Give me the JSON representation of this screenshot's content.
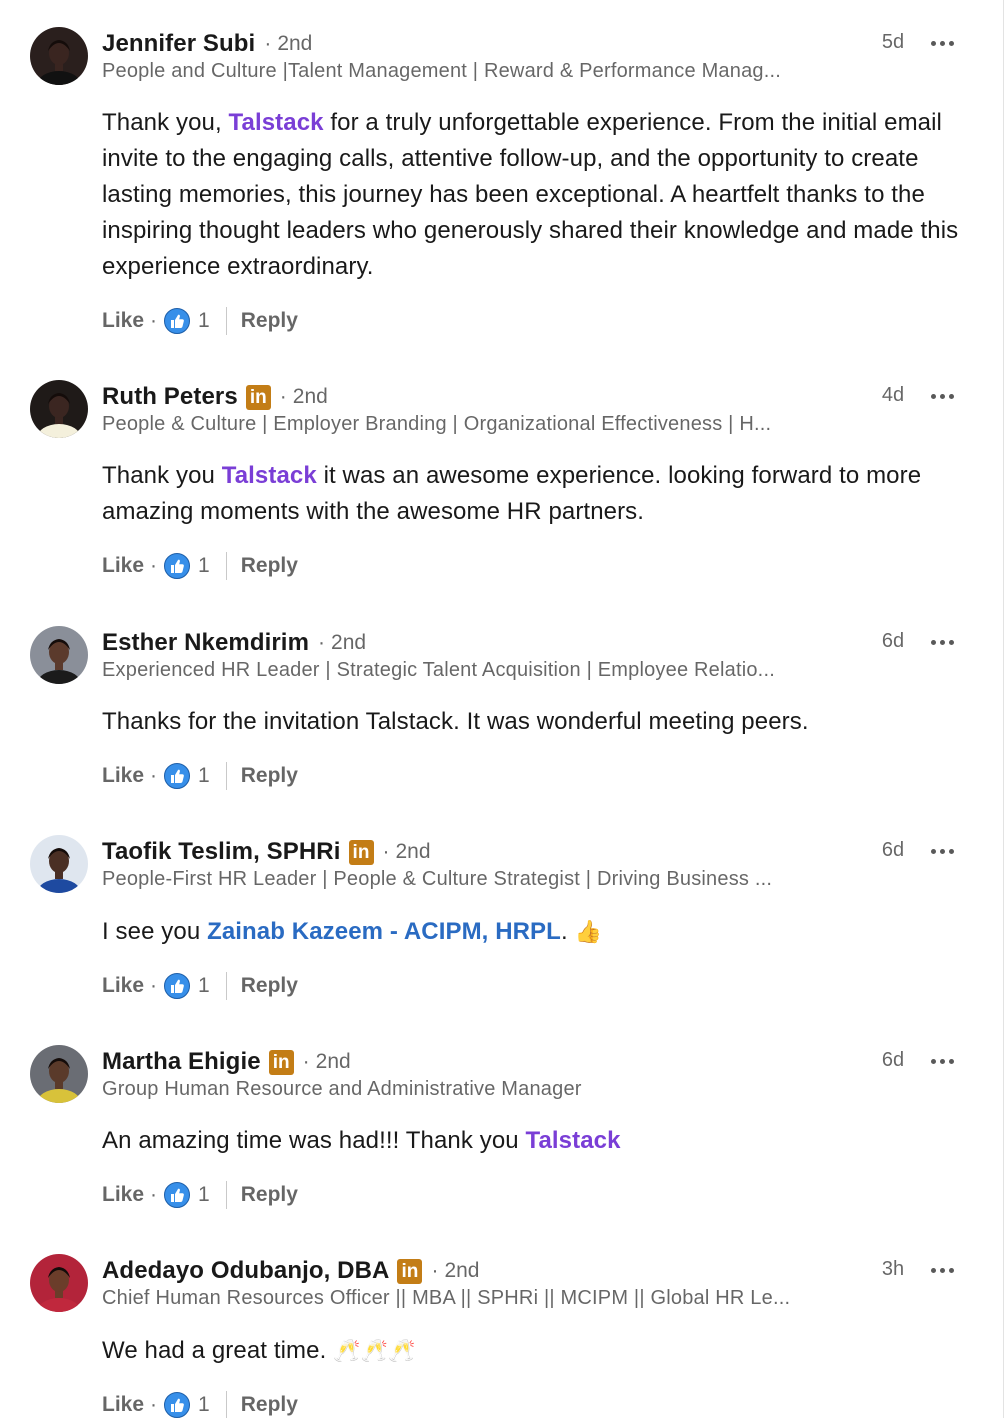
{
  "comments": [
    {
      "author": "Jennifer Subi",
      "badge": false,
      "degree": "2nd",
      "headline": "People and Culture |Talent Management | Reward & Performance Manag...",
      "time": "5d",
      "body": [
        {
          "t": "Thank you, "
        },
        {
          "m": "Talstack"
        },
        {
          "t": " for a truly unforgettable experience. From the initial email invite to the engaging calls, attentive follow-up, and the opportunity to create lasting memories, this journey has been exceptional. A heartfelt thanks to the inspiring thought leaders who generously shared their knowledge and made this experience extraordinary."
        }
      ],
      "like_label": "Like",
      "reaction_count": "1",
      "reply_label": "Reply"
    },
    {
      "author": "Ruth Peters",
      "badge": true,
      "degree": "2nd",
      "headline": "People & Culture | Employer Branding | Organizational Effectiveness | H...",
      "time": "4d",
      "body": [
        {
          "t": "Thank you "
        },
        {
          "m": "Talstack"
        },
        {
          "t": " it was an awesome experience. looking forward to more amazing moments with the awesome HR partners."
        }
      ],
      "like_label": "Like",
      "reaction_count": "1",
      "reply_label": "Reply"
    },
    {
      "author": "Esther Nkemdirim",
      "badge": false,
      "degree": "2nd",
      "headline": "Experienced HR Leader | Strategic Talent Acquisition | Employee Relatio...",
      "time": "6d",
      "body": [
        {
          "t": "Thanks for the invitation Talstack. It was wonderful meeting peers."
        }
      ],
      "like_label": "Like",
      "reaction_count": "1",
      "reply_label": "Reply"
    },
    {
      "author": "Taofik Teslim, SPHRi",
      "badge": true,
      "degree": "2nd",
      "headline": "People-First HR Leader | People & Culture Strategist | Driving Business ...",
      "time": "6d",
      "body": [
        {
          "t": "I see you "
        },
        {
          "p": "Zainab Kazeem - ACIPM, HRPL"
        },
        {
          "t": ". "
        },
        {
          "e": "👍"
        }
      ],
      "like_label": "Like",
      "reaction_count": "1",
      "reply_label": "Reply"
    },
    {
      "author": "Martha Ehigie",
      "badge": true,
      "degree": "2nd",
      "headline": "Group Human Resource and Administrative Manager",
      "time": "6d",
      "body": [
        {
          "t": "An amazing time was had!!! Thank you "
        },
        {
          "m": "Talstack"
        }
      ],
      "like_label": "Like",
      "reaction_count": "1",
      "reply_label": "Reply"
    },
    {
      "author": "Adedayo Odubanjo, DBA",
      "badge": true,
      "degree": "2nd",
      "headline": "Chief Human Resources Officer || MBA || SPHRi || MCIPM || Global HR Le...",
      "time": "3h",
      "body": [
        {
          "t": "We had a great time. "
        },
        {
          "e": "🥂🥂🥂"
        }
      ],
      "like_label": "Like",
      "reaction_count": "1",
      "reply_label": "Reply"
    }
  ],
  "badge_text": "in",
  "separator_dot": "·",
  "avatar_colors": [
    "#2a1f1d",
    "#1f1a18",
    "#8a8f99",
    "#dfe6ef",
    "#6a6d74",
    "#b3243a"
  ],
  "colors": {
    "mention_purple": "#7a3ed6",
    "mention_blue": "#2a6bc2",
    "premium_badge": "#c37d16",
    "reaction_blue": "#378fe9"
  },
  "icons": {
    "more": "ellipsis-icon",
    "reaction": "thumbs-up-reaction-icon",
    "badge": "linkedin-premium-badge-icon"
  }
}
